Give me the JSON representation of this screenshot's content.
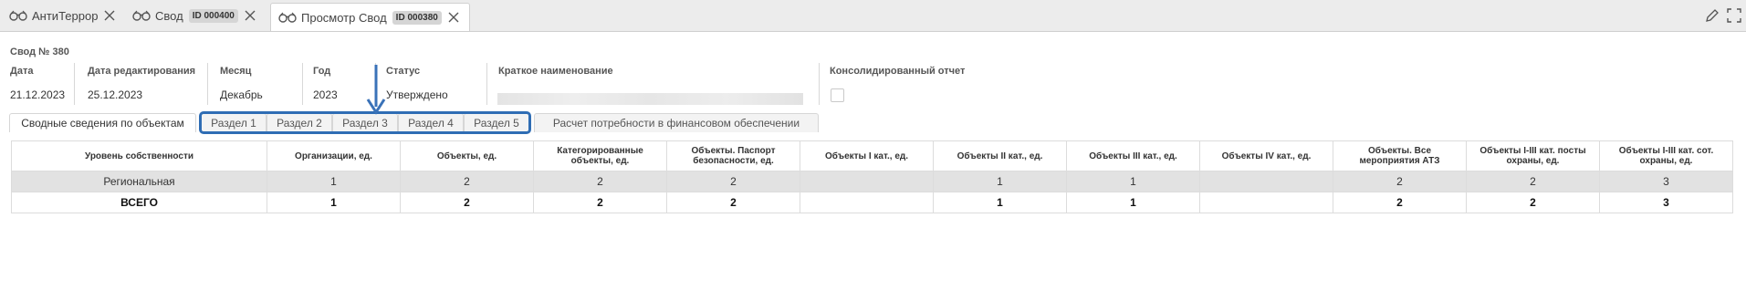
{
  "tabs": [
    {
      "label": "АнтиТеррор",
      "id": ""
    },
    {
      "label": "Свод",
      "id": "ID 000400"
    },
    {
      "label": "Просмотр Свод",
      "id": "ID 000380"
    }
  ],
  "header": {
    "title": "Свод № 380",
    "fields": [
      {
        "label": "Дата",
        "value": "21.12.2023"
      },
      {
        "label": "Дата редактирования",
        "value": "25.12.2023"
      },
      {
        "label": "Месяц",
        "value": "Декабрь"
      },
      {
        "label": "Год",
        "value": "2023"
      },
      {
        "label": "Статус",
        "value": "Утверждено"
      },
      {
        "label": "Краткое наименование",
        "value": ""
      },
      {
        "label": "Консолидированный отчет",
        "value": ""
      }
    ]
  },
  "subtabs": [
    "Сводные сведения по объектам",
    "Раздел 1",
    "Раздел 2",
    "Раздел 3",
    "Раздел 4",
    "Раздел 5",
    "Расчет потребности в финансовом обеспечении"
  ],
  "table": {
    "columns": [
      "Уровень собственности",
      "Организации, ед.",
      "Объекты, ед.",
      "Категорированные объекты, ед.",
      "Объекты. Паспорт безопасности, ед.",
      "Объекты I кат., ед.",
      "Объекты II кат., ед.",
      "Объекты III кат., ед.",
      "Объекты IV кат., ед.",
      "Объекты. Все мероприятия АТЗ",
      "Объекты I-III кат. посты охраны, ед.",
      "Объекты I-III кат. сот. охраны, ед."
    ],
    "rows": [
      [
        "Региональная",
        "1",
        "2",
        "2",
        "2",
        "",
        "1",
        "1",
        "",
        "2",
        "2",
        "3"
      ],
      [
        "ВСЕГО",
        "1",
        "2",
        "2",
        "2",
        "",
        "1",
        "1",
        "",
        "2",
        "2",
        "3"
      ]
    ]
  },
  "colors": {
    "highlight": "#2f6db4",
    "arrow": "#3a72b8"
  }
}
